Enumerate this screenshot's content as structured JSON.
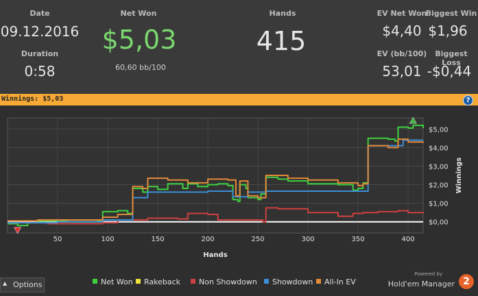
{
  "stats": {
    "date_label": "Date",
    "date_value": "09.12.2016",
    "duration_label": "Duration",
    "duration_value": "0:58",
    "net_won_label": "Net Won",
    "net_won_value": "$5,03",
    "bb_per_100": "60,60 bb/100",
    "hands_label": "Hands",
    "hands_value": "415",
    "ev_net_won_label": "EV Net Won",
    "ev_net_won_value": "$4,40",
    "biggest_win_label": "Biggest Win",
    "biggest_win_value": "$1,96",
    "ev_bb100_label": "EV (bb/100)",
    "ev_bb100_value": "53,01",
    "biggest_loss_label": "Biggest Loss",
    "biggest_loss_value": "-$0,44",
    "net_won_color": "#7bd86f"
  },
  "winnings_bar": {
    "text": "Winnings: $5,03",
    "help_label": "?",
    "color": "#f6a935"
  },
  "footer": {
    "options_label": "Options",
    "powered_by": "Powered by",
    "brand": "Hold'em Manager",
    "brand_badge": "2"
  },
  "chart_data": {
    "type": "line",
    "xlabel": "Hands",
    "ylabel": "Winnings",
    "x_ticks": [
      50,
      100,
      150,
      200,
      250,
      300,
      350,
      400
    ],
    "y_ticks": [
      "$0,00",
      "$1,00",
      "$2,00",
      "$3,00",
      "$4,00",
      "$5,00"
    ],
    "xlim": [
      0,
      415
    ],
    "ylim": [
      -0.6,
      5.6
    ],
    "grid": true,
    "legend": "bottom",
    "series": [
      {
        "name": "Net Won",
        "color": "#3fd23f",
        "points": [
          [
            0,
            -0.1
          ],
          [
            10,
            -0.2
          ],
          [
            20,
            -0.05
          ],
          [
            30,
            0.05
          ],
          [
            60,
            0.0
          ],
          [
            90,
            0.05
          ],
          [
            95,
            0.55
          ],
          [
            110,
            0.6
          ],
          [
            120,
            0.45
          ],
          [
            125,
            1.8
          ],
          [
            135,
            1.6
          ],
          [
            140,
            1.9
          ],
          [
            150,
            1.75
          ],
          [
            160,
            2.05
          ],
          [
            175,
            1.8
          ],
          [
            180,
            2.05
          ],
          [
            190,
            1.9
          ],
          [
            200,
            2.0
          ],
          [
            210,
            2.05
          ],
          [
            220,
            1.95
          ],
          [
            225,
            1.2
          ],
          [
            230,
            1.1
          ],
          [
            232,
            2.0
          ],
          [
            238,
            1.8
          ],
          [
            240,
            1.3
          ],
          [
            245,
            1.3
          ],
          [
            250,
            1.2
          ],
          [
            253,
            1.5
          ],
          [
            258,
            2.4
          ],
          [
            270,
            2.3
          ],
          [
            280,
            2.2
          ],
          [
            300,
            2.05
          ],
          [
            330,
            2.0
          ],
          [
            345,
            1.7
          ],
          [
            350,
            1.8
          ],
          [
            355,
            2.1
          ],
          [
            360,
            4.5
          ],
          [
            380,
            4.45
          ],
          [
            387,
            4.35
          ],
          [
            390,
            5.1
          ],
          [
            400,
            5.05
          ],
          [
            405,
            5.2
          ],
          [
            415,
            5.05
          ]
        ]
      },
      {
        "name": "Rakeback",
        "color": "#f0e03a",
        "points": [
          [
            0,
            0.0
          ],
          [
            415,
            0.0
          ]
        ]
      },
      {
        "name": "Non Showdown",
        "color": "#d04040",
        "points": [
          [
            0,
            -0.05
          ],
          [
            40,
            -0.1
          ],
          [
            95,
            -0.05
          ],
          [
            110,
            0.1
          ],
          [
            140,
            0.2
          ],
          [
            170,
            0.15
          ],
          [
            180,
            0.45
          ],
          [
            200,
            0.4
          ],
          [
            210,
            0.1
          ],
          [
            250,
            0.1
          ],
          [
            255,
            0.0
          ],
          [
            258,
            0.75
          ],
          [
            270,
            0.7
          ],
          [
            300,
            0.5
          ],
          [
            330,
            0.3
          ],
          [
            345,
            0.45
          ],
          [
            355,
            0.5
          ],
          [
            370,
            0.55
          ],
          [
            390,
            0.6
          ],
          [
            400,
            0.5
          ],
          [
            415,
            0.45
          ]
        ]
      },
      {
        "name": "Showdown",
        "color": "#3c8fd6",
        "points": [
          [
            0,
            -0.05
          ],
          [
            50,
            0.0
          ],
          [
            95,
            0.1
          ],
          [
            125,
            1.3
          ],
          [
            140,
            1.6
          ],
          [
            200,
            1.65
          ],
          [
            225,
            1.35
          ],
          [
            240,
            1.6
          ],
          [
            255,
            1.6
          ],
          [
            258,
            1.65
          ],
          [
            330,
            1.65
          ],
          [
            355,
            1.65
          ],
          [
            360,
            4.1
          ],
          [
            390,
            4.1
          ],
          [
            395,
            4.4
          ],
          [
            415,
            4.4
          ]
        ]
      },
      {
        "name": "All-In EV",
        "color": "#e38a3a",
        "points": [
          [
            0,
            0.05
          ],
          [
            30,
            0.1
          ],
          [
            95,
            0.25
          ],
          [
            110,
            0.4
          ],
          [
            125,
            1.9
          ],
          [
            135,
            1.8
          ],
          [
            140,
            2.35
          ],
          [
            160,
            2.25
          ],
          [
            180,
            2.1
          ],
          [
            200,
            2.3
          ],
          [
            220,
            2.25
          ],
          [
            228,
            1.4
          ],
          [
            232,
            2.2
          ],
          [
            240,
            1.4
          ],
          [
            250,
            1.3
          ],
          [
            258,
            2.5
          ],
          [
            280,
            2.35
          ],
          [
            300,
            2.25
          ],
          [
            330,
            2.1
          ],
          [
            350,
            1.95
          ],
          [
            355,
            2.05
          ],
          [
            360,
            4.1
          ],
          [
            380,
            4.0
          ],
          [
            390,
            4.45
          ],
          [
            400,
            4.3
          ],
          [
            415,
            4.25
          ]
        ]
      }
    ],
    "markers": [
      {
        "name": "max-marker",
        "x": 405,
        "y": 5.45,
        "color": "#3fae3f"
      },
      {
        "name": "min-marker",
        "x": 10,
        "y": -0.45,
        "color": "#e03030"
      }
    ]
  }
}
